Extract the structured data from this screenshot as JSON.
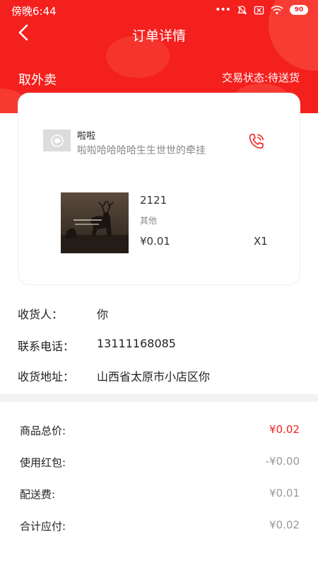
{
  "status_bar": {
    "time": "傍晚6:44",
    "battery": "90"
  },
  "header": {
    "title": "订单详情",
    "order_type": "取外卖",
    "status_text": "交易状态:待送货"
  },
  "shop": {
    "name": "啦啦",
    "description": "啦啦哈哈哈哈生生世世的牵挂"
  },
  "product": {
    "name": "2121",
    "category": "其他",
    "price": "¥0.01",
    "quantity": "X1"
  },
  "recipient": {
    "name_label": "收货人：",
    "name": "你",
    "phone_label": "联系电话：",
    "phone": "13111168085",
    "address_label": "收货地址：",
    "address": "山西省太原市小店区你"
  },
  "fees": [
    {
      "label": "商品总价:",
      "value": "¥0.02",
      "accent": true
    },
    {
      "label": "使用红包:",
      "value": "-¥0.00",
      "accent": false
    },
    {
      "label": "配送费:",
      "value": "¥0.01",
      "accent": false
    },
    {
      "label": "合计应付:",
      "value": "¥0.02",
      "accent": false
    }
  ],
  "colors": {
    "accent": "#f4201e",
    "muted": "#999999"
  },
  "icons": {
    "back": "back-arrow-icon",
    "phone": "phone-call-icon"
  }
}
